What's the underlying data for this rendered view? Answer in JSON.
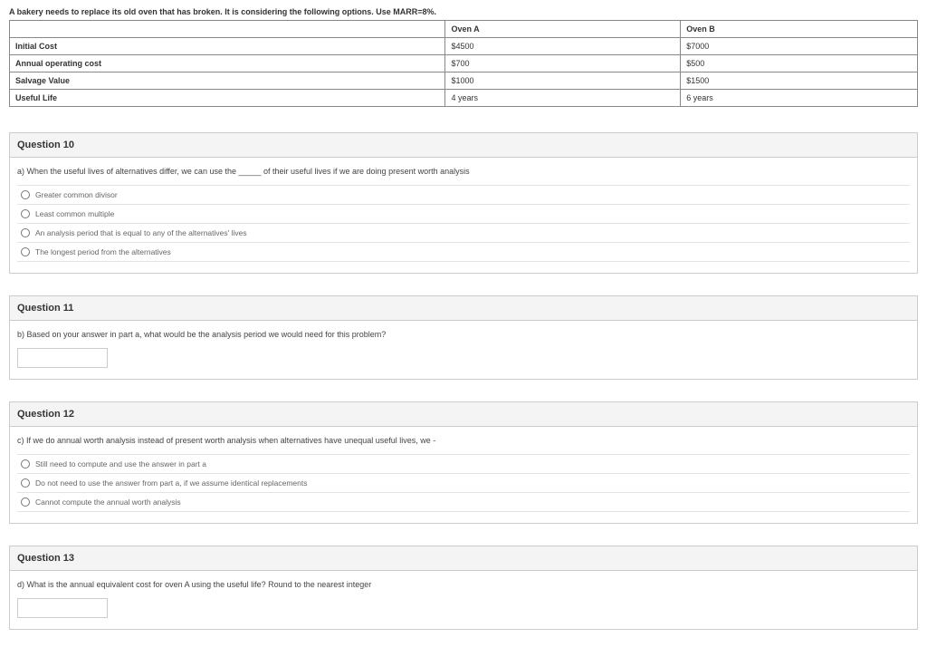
{
  "intro": "A bakery needs to replace its old oven that has broken. It is considering the following options. Use MARR=8%.",
  "table": {
    "colA": "Oven A",
    "colB": "Oven B",
    "rows": [
      {
        "label": "Initial Cost",
        "a": "$4500",
        "b": "$7000"
      },
      {
        "label": "Annual operating cost",
        "a": "$700",
        "b": "$500"
      },
      {
        "label": "Salvage Value",
        "a": "$1000",
        "b": "$1500"
      },
      {
        "label": "Useful Life",
        "a": "4 years",
        "b": "6 years"
      }
    ]
  },
  "q10": {
    "title": "Question 10",
    "prompt": "a) When the useful lives of alternatives differ, we can use the _____ of their useful lives if we are doing present worth analysis",
    "options": [
      "Greater common divisor",
      "Least common multiple",
      "An analysis period that is equal to any of the alternatives' lives",
      "The longest period from the alternatives"
    ]
  },
  "q11": {
    "title": "Question 11",
    "prompt": "b) Based on your answer in part a, what would be the analysis period we would need for this problem?"
  },
  "q12": {
    "title": "Question 12",
    "prompt": "c) If we do annual worth analysis instead of present worth analysis when alternatives have unequal useful lives, we -",
    "options": [
      "Still need to compute and use the answer in part a",
      "Do not need to use the answer from part a, if we assume identical replacements",
      "Cannot compute the annual worth analysis"
    ]
  },
  "q13": {
    "title": "Question 13",
    "prompt": "d) What is the annual equivalent cost for oven A using the useful life? Round to the nearest integer"
  }
}
